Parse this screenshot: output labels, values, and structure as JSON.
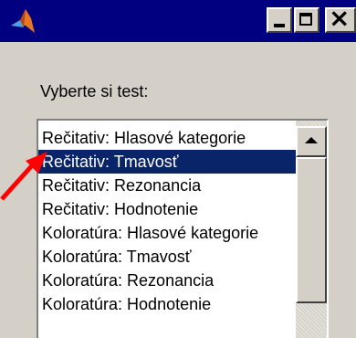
{
  "window": {
    "icon": "matlab-logo-icon",
    "controls": [
      "minimize-icon",
      "maximize-icon",
      "close-icon"
    ]
  },
  "prompt_label": "Vyberte si test:",
  "listbox": {
    "items": [
      "Rečitativ: Hlasové kategorie",
      "Rečitativ: Tmavosť",
      "Rečitativ: Rezonancia",
      "Rečitativ: Hodnotenie",
      "Koloratúra: Hlasové kategorie",
      "Koloratúra: Tmavosť",
      "Koloratúra: Rezonancia",
      "Koloratúra: Hodnotenie"
    ],
    "selected_index": 1
  },
  "colors": {
    "titlebar": "#000080",
    "selection": "#0a246a",
    "annotation_arrow": "#ff0000"
  }
}
